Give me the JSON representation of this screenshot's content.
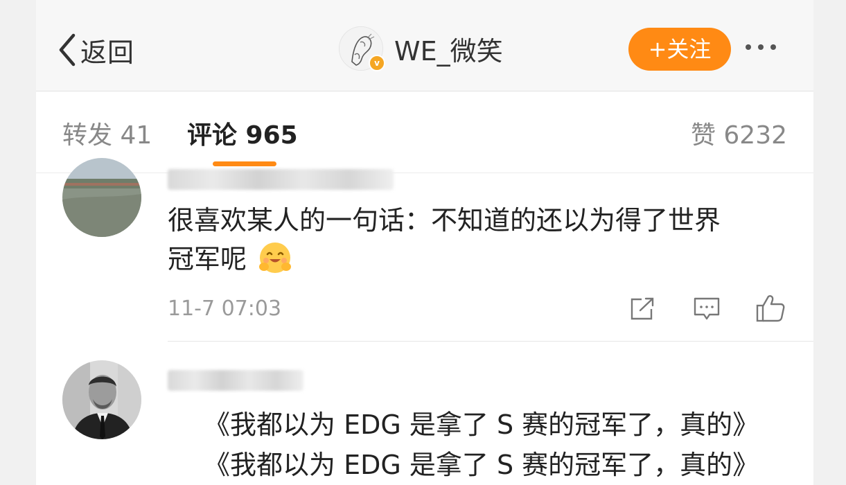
{
  "header": {
    "back_label": "返回",
    "username": "WE_微笑",
    "follow_label": "+关注"
  },
  "tabs": {
    "repost": "转发 41",
    "comments": "评论 965",
    "likes": "赞 6232"
  },
  "comments": [
    {
      "text_line1": "很喜欢某人的一句话：不知道的还以为得了世界",
      "text_line2": "冠军呢",
      "time": "11-7 07:03",
      "emoji": "hug-emoji"
    },
    {
      "text_line1": "《我都以为 EDG 是拿了 S 赛的冠军了，真的》",
      "text_line2": "《我都以为 EDG 是拿了 S 赛的冠军了，真的》"
    }
  ],
  "colors": {
    "accent": "#ff8a14",
    "verified": "#f5a623",
    "text_primary": "#222222",
    "text_secondary": "#9a9a9a"
  },
  "icons": {
    "back": "chevron-left-icon",
    "more": "more-dots-icon",
    "share": "share-icon",
    "reply": "comment-icon",
    "like": "thumbs-up-icon"
  }
}
